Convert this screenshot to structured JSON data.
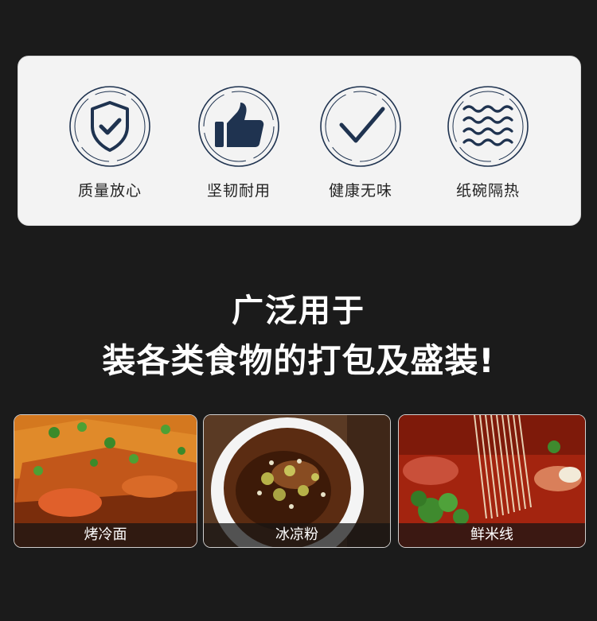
{
  "features": [
    {
      "label": "质量放心",
      "icon": "shield-check-icon"
    },
    {
      "label": "坚韧耐用",
      "icon": "thumbs-up-icon"
    },
    {
      "label": "健康无味",
      "icon": "checkmark-icon"
    },
    {
      "label": "纸碗隔热",
      "icon": "heat-waves-icon"
    }
  ],
  "headline": {
    "line1": "广泛用于",
    "line2": "装各类食物的打包及盛装!"
  },
  "foods": [
    {
      "caption": "烤冷面"
    },
    {
      "caption": "冰凉粉"
    },
    {
      "caption": "鲜米线"
    }
  ],
  "colors": {
    "background": "#1b1b1b",
    "card": "#f3f3f3",
    "icon": "#1f3350"
  }
}
